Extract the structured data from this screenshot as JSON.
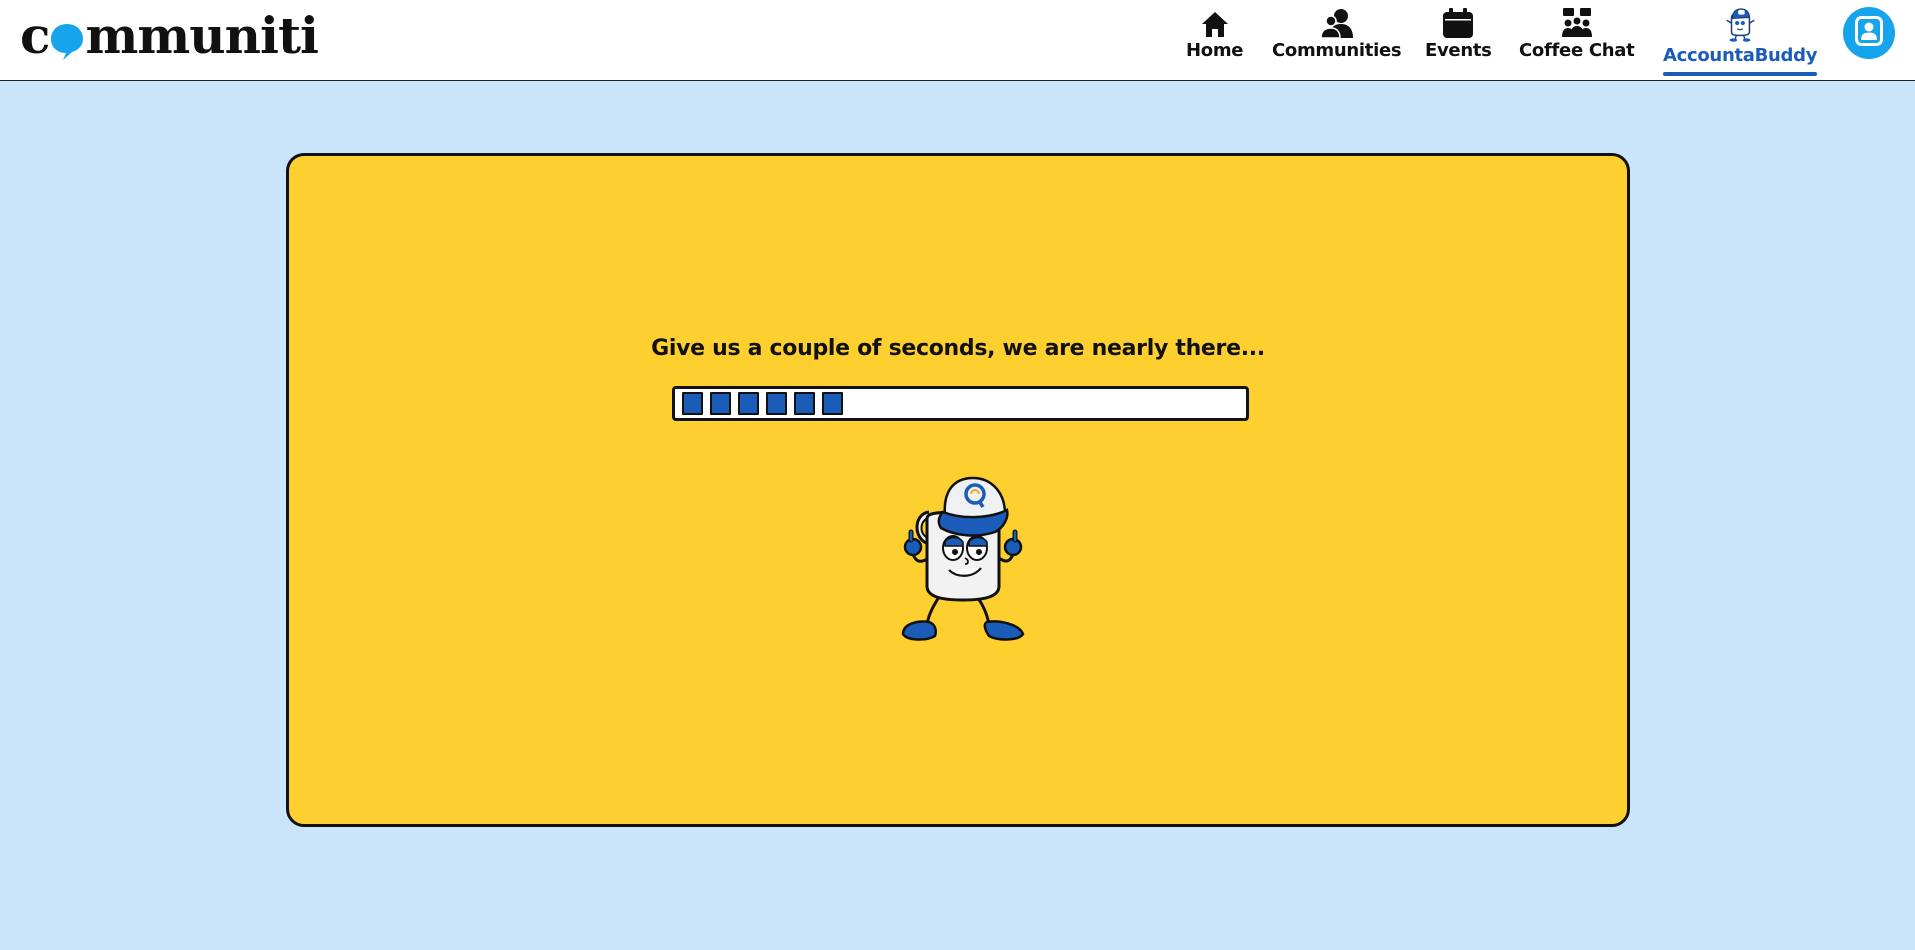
{
  "header": {
    "logo_text": {
      "before": "c",
      "after": "mmuniti"
    },
    "logo_accent": "#16a4ec",
    "nav": [
      {
        "label": "Home",
        "icon": "home-icon"
      },
      {
        "label": "Communities",
        "icon": "communities-icon"
      },
      {
        "label": "Events",
        "icon": "calendar-icon"
      },
      {
        "label": "Coffee Chat",
        "icon": "coffee-chat-icon"
      },
      {
        "label": "AccountaBuddy",
        "icon": "accountabuddy-mascot-icon",
        "active": true
      }
    ],
    "profile_icon": "user-profile-icon"
  },
  "loader": {
    "message": "Give us a couple of seconds, we are nearly there...",
    "progress_segments_filled": 6,
    "progress_fraction": 0.27
  },
  "colors": {
    "page_background": "#cae5fa",
    "card_background": "#fdd02f",
    "accent_blue": "#1a5cb8",
    "profile_blue": "#16a4ec"
  }
}
